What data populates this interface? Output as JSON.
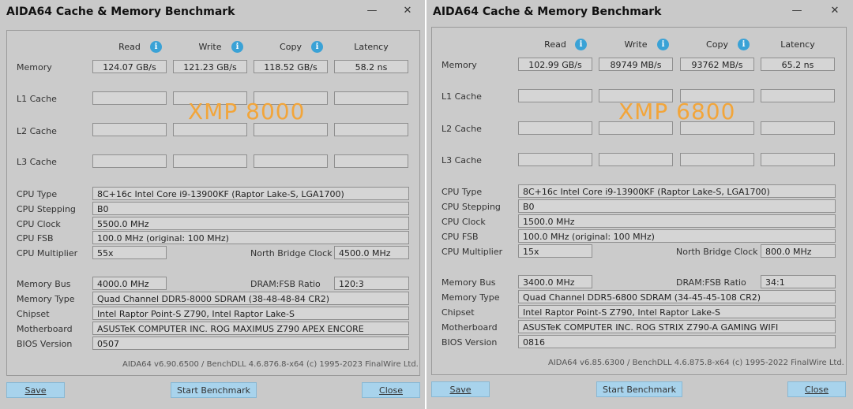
{
  "windows": [
    {
      "title": "AIDA64 Cache & Memory Benchmark",
      "overlay": "XMP 8000",
      "headers": {
        "read": "Read",
        "write": "Write",
        "copy": "Copy",
        "latency": "Latency"
      },
      "rows": {
        "memory": {
          "label": "Memory",
          "read": "124.07 GB/s",
          "write": "121.23 GB/s",
          "copy": "118.52 GB/s",
          "latency": "58.2 ns"
        },
        "l1": {
          "label": "L1 Cache"
        },
        "l2": {
          "label": "L2 Cache"
        },
        "l3": {
          "label": "L3 Cache"
        }
      },
      "info": {
        "cpu_type": {
          "label": "CPU Type",
          "value": "8C+16c Intel Core i9-13900KF  (Raptor Lake-S, LGA1700)"
        },
        "cpu_stepping": {
          "label": "CPU Stepping",
          "value": "B0"
        },
        "cpu_clock": {
          "label": "CPU Clock",
          "value": "5500.0 MHz"
        },
        "cpu_fsb": {
          "label": "CPU FSB",
          "value": "100.0 MHz  (original: 100 MHz)"
        },
        "cpu_multiplier": {
          "label": "CPU Multiplier",
          "value": "55x"
        },
        "nb_clock": {
          "label": "North Bridge Clock",
          "value": "4500.0 MHz"
        },
        "memory_bus": {
          "label": "Memory Bus",
          "value": "4000.0 MHz"
        },
        "dram_fsb": {
          "label": "DRAM:FSB Ratio",
          "value": "120:3"
        },
        "memory_type": {
          "label": "Memory Type",
          "value": "Quad Channel DDR5-8000 SDRAM  (38-48-48-84 CR2)"
        },
        "chipset": {
          "label": "Chipset",
          "value": "Intel Raptor Point-S Z790, Intel Raptor Lake-S"
        },
        "motherboard": {
          "label": "Motherboard",
          "value": "ASUSTeK COMPUTER INC. ROG MAXIMUS Z790 APEX ENCORE"
        },
        "bios": {
          "label": "BIOS Version",
          "value": "0507"
        }
      },
      "footer": "AIDA64 v6.90.6500 / BenchDLL 4.6.876.8-x64  (c) 1995-2023 FinalWire Ltd.",
      "buttons": {
        "save": "Save",
        "start": "Start Benchmark",
        "close": "Close"
      }
    },
    {
      "title": "AIDA64 Cache & Memory Benchmark",
      "overlay": "XMP 6800",
      "headers": {
        "read": "Read",
        "write": "Write",
        "copy": "Copy",
        "latency": "Latency"
      },
      "rows": {
        "memory": {
          "label": "Memory",
          "read": "102.99 GB/s",
          "write": "89749 MB/s",
          "copy": "93762 MB/s",
          "latency": "65.2 ns"
        },
        "l1": {
          "label": "L1 Cache"
        },
        "l2": {
          "label": "L2 Cache"
        },
        "l3": {
          "label": "L3 Cache"
        }
      },
      "info": {
        "cpu_type": {
          "label": "CPU Type",
          "value": "8C+16c Intel Core i9-13900KF  (Raptor Lake-S, LGA1700)"
        },
        "cpu_stepping": {
          "label": "CPU Stepping",
          "value": "B0"
        },
        "cpu_clock": {
          "label": "CPU Clock",
          "value": "1500.0 MHz"
        },
        "cpu_fsb": {
          "label": "CPU FSB",
          "value": "100.0 MHz  (original: 100 MHz)"
        },
        "cpu_multiplier": {
          "label": "CPU Multiplier",
          "value": "15x"
        },
        "nb_clock": {
          "label": "North Bridge Clock",
          "value": "800.0 MHz"
        },
        "memory_bus": {
          "label": "Memory Bus",
          "value": "3400.0 MHz"
        },
        "dram_fsb": {
          "label": "DRAM:FSB Ratio",
          "value": "34:1"
        },
        "memory_type": {
          "label": "Memory Type",
          "value": "Quad Channel DDR5-6800 SDRAM  (34-45-45-108 CR2)"
        },
        "chipset": {
          "label": "Chipset",
          "value": "Intel Raptor Point-S Z790, Intel Raptor Lake-S"
        },
        "motherboard": {
          "label": "Motherboard",
          "value": "ASUSTeK COMPUTER INC. ROG STRIX Z790-A GAMING WIFI"
        },
        "bios": {
          "label": "BIOS Version",
          "value": "0816"
        }
      },
      "footer": "AIDA64 v6.85.6300 / BenchDLL 4.6.875.8-x64  (c) 1995-2022 FinalWire Ltd.",
      "buttons": {
        "save": "Save",
        "start": "Start Benchmark",
        "close": "Close"
      }
    }
  ]
}
